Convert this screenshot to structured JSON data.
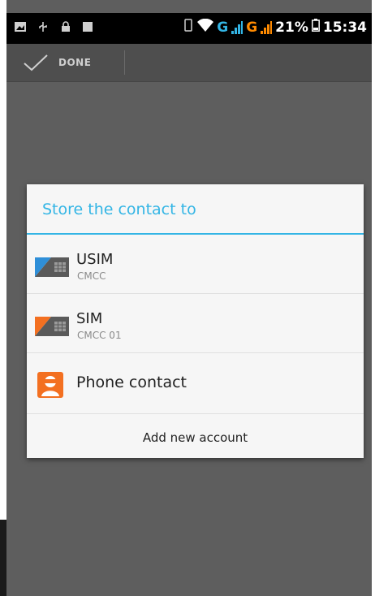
{
  "status_bar": {
    "network_g1": "G",
    "network_g2": "G",
    "battery": "21%",
    "time": "15:34"
  },
  "action_bar": {
    "done_label": "DONE"
  },
  "dialog": {
    "title": "Store the contact to",
    "options": [
      {
        "name": "USIM",
        "sub": "CMCC",
        "icon": "sim-card-blue-icon"
      },
      {
        "name": "SIM",
        "sub": "CMCC 01",
        "icon": "sim-card-orange-icon"
      },
      {
        "name": "Phone contact",
        "icon": "person-icon"
      }
    ],
    "add_account_label": "Add new account"
  },
  "colors": {
    "accent": "#33b5e5",
    "sim_blue": "#2f8fd8",
    "sim_orange": "#f37021",
    "scrim": "#5e5e5e"
  }
}
